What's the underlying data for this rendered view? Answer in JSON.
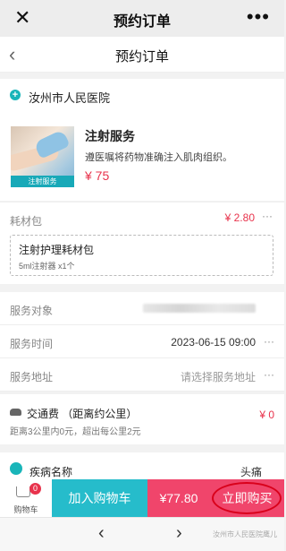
{
  "wechat_bar": {
    "title": "预约订单",
    "close_icon": "close-icon",
    "more_icon": "more-icon"
  },
  "nav": {
    "title": "预约订单",
    "back_icon": "chevron-left-icon"
  },
  "hospital": {
    "name": "汝州市人民医院",
    "icon": "plus-circle-icon"
  },
  "service": {
    "name": "注射服务",
    "description": "遵医嘱将药物准确注入肌肉组织。",
    "price": "¥ 75",
    "image_label": "注射服务"
  },
  "materials": {
    "label": "耗材包",
    "price": "¥ 2.80",
    "more": "···",
    "package_name": "注射护理耗材包",
    "package_item": "5ml注射器 x1个"
  },
  "rows": {
    "service_target": {
      "label": "服务对象"
    },
    "service_time": {
      "label": "服务时间",
      "value": "2023-06-15  09:00",
      "more": "···"
    },
    "service_address": {
      "label": "服务地址",
      "value": "请选择服务地址",
      "more": "···"
    }
  },
  "transport": {
    "title": "交通费 （距离约公里）",
    "price": "¥ 0",
    "note": "距离3公里内0元，超出每公里2元",
    "icon": "car-icon"
  },
  "disease": {
    "label": "疾病名称",
    "value": "头痛",
    "icon": "disease-icon"
  },
  "bottom": {
    "cart_label": "购物车",
    "cart_count": "0",
    "add_to_cart": "加入购物车",
    "total": "¥77.80",
    "buy_now": "立即购买"
  },
  "browser": {
    "back": "‹",
    "forward": "›",
    "watermark": "汝州市人民医院鹰儿"
  },
  "colors": {
    "accent_teal": "#26bccb",
    "price_red": "#e8334c",
    "buy_pink": "#f0456b"
  }
}
